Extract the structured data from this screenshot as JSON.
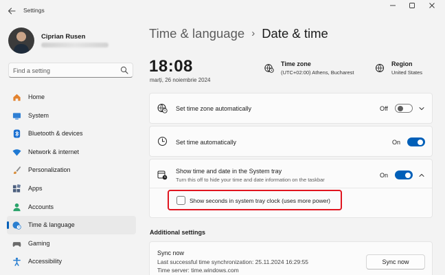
{
  "window": {
    "app_title": "Settings",
    "back_icon": "arrow-left-icon",
    "controls": [
      "minimize-icon",
      "maximize-icon",
      "close-icon"
    ]
  },
  "profile": {
    "name": "Ciprian Rusen"
  },
  "search": {
    "placeholder": "Find a setting",
    "icon": "search-icon"
  },
  "sidebar": {
    "items": [
      {
        "label": "Home",
        "icon": "home-icon",
        "color": "#e3832f"
      },
      {
        "label": "System",
        "icon": "system-icon",
        "color": "#2f7fd4"
      },
      {
        "label": "Bluetooth & devices",
        "icon": "bluetooth-icon",
        "color": "#1a6fd1"
      },
      {
        "label": "Network & internet",
        "icon": "wifi-icon",
        "color": "#1f79d3"
      },
      {
        "label": "Personalization",
        "icon": "paintbrush-icon",
        "color": "#d98e3a"
      },
      {
        "label": "Apps",
        "icon": "apps-icon",
        "color": "#4c5f7e"
      },
      {
        "label": "Accounts",
        "icon": "accounts-icon",
        "color": "#2aa36b"
      },
      {
        "label": "Time & language",
        "icon": "globe-clock-icon",
        "color": "#2a7fd0",
        "selected": true
      },
      {
        "label": "Gaming",
        "icon": "gaming-icon",
        "color": "#6b6b6b"
      },
      {
        "label": "Accessibility",
        "icon": "accessibility-icon",
        "color": "#2a7fd0"
      }
    ]
  },
  "header": {
    "parent": "Time & language",
    "separator": "›",
    "current": "Date & time"
  },
  "clock": {
    "time": "18:08",
    "date": "marți, 26 noiembrie 2024"
  },
  "time_zone": {
    "title": "Time zone",
    "value": "(UTC+02:00) Athens, Bucharest",
    "icon": "globe-clock-icon"
  },
  "region": {
    "title": "Region",
    "value": "United States",
    "icon": "globe-icon"
  },
  "settings": {
    "auto_timezone": {
      "label": "Set time zone automatically",
      "state": "Off",
      "on": false,
      "icon": "globe-clock-icon"
    },
    "auto_time": {
      "label": "Set time automatically",
      "state": "On",
      "on": true,
      "icon": "clock-icon"
    },
    "tray": {
      "label": "Show time and date in the System tray",
      "description": "Turn this off to hide your time and date information on the taskbar",
      "state": "On",
      "on": true,
      "icon": "calendar-clock-icon",
      "expanded": true,
      "seconds_checkbox": {
        "label": "Show seconds in system tray clock (uses more power)",
        "checked": false
      }
    }
  },
  "additional": {
    "title": "Additional settings",
    "sync": {
      "title": "Sync now",
      "last_sync": "Last successful time synchronization: 25.11.2024 16:29:55",
      "server": "Time server: time.windows.com",
      "button": "Sync now"
    }
  },
  "colors": {
    "accent": "#005fb8",
    "highlight": "#e0141e",
    "background": "#f3f3f3",
    "card": "#fbfbfb"
  }
}
